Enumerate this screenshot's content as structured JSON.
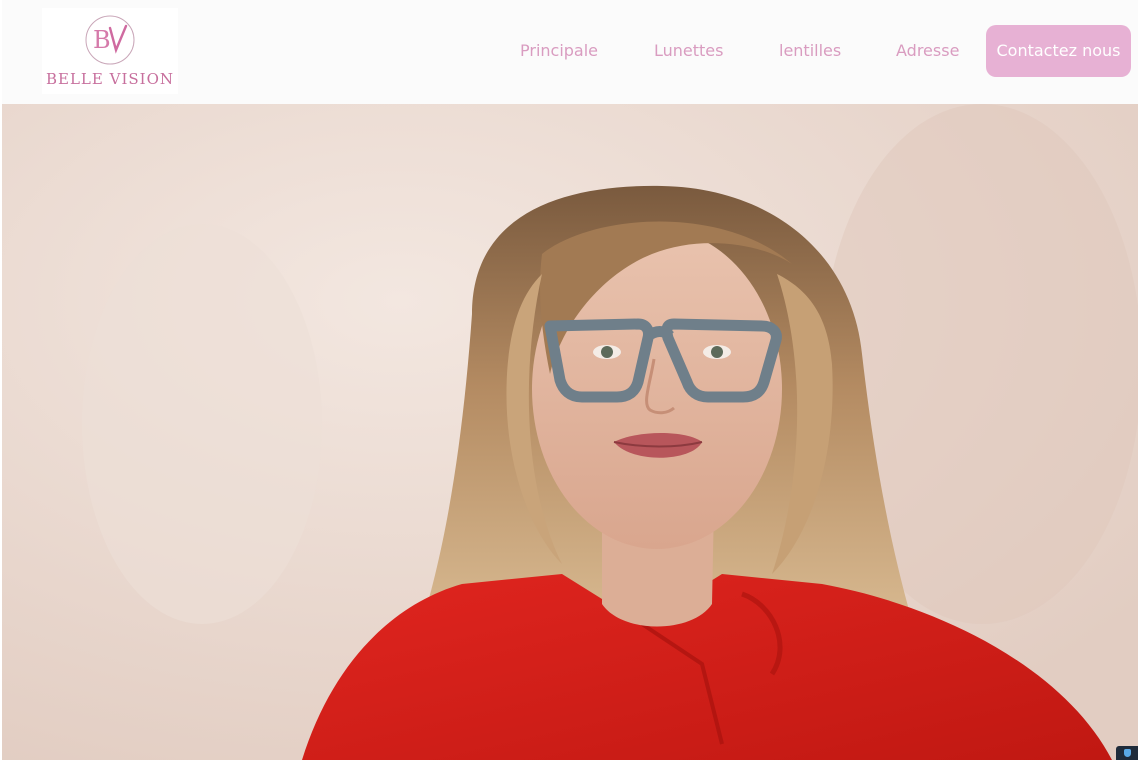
{
  "brand": {
    "monogram": "BV",
    "name": "BELLE VISION"
  },
  "nav": {
    "items": [
      {
        "label": "Principale"
      },
      {
        "label": "Lunettes"
      },
      {
        "label": "lentilles"
      },
      {
        "label": "Adresse"
      }
    ],
    "contact_label": "Contactez nous"
  },
  "hero": {
    "image": "portrait-woman-glasses-red-blouse"
  },
  "colors": {
    "accent_pink": "#e7b1d4",
    "nav_text": "#d99cc0",
    "logo_text": "#c76f9d",
    "header_bg": "#fbfbfb"
  }
}
